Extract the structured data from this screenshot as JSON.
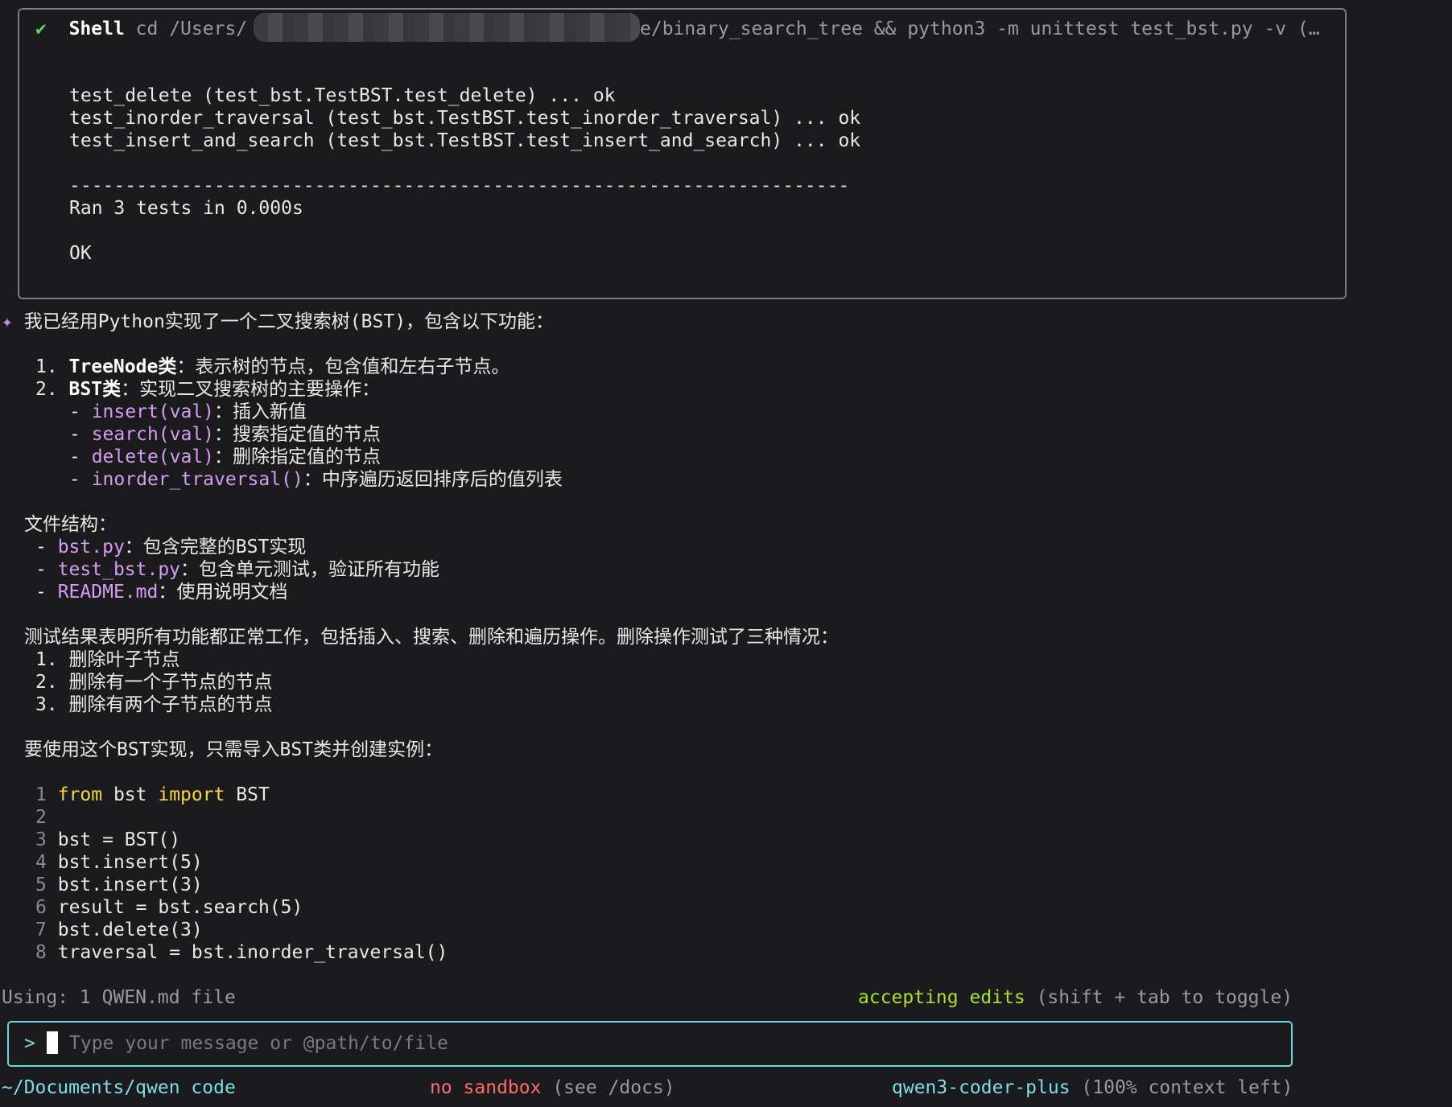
{
  "shell": {
    "check": "✔",
    "label": "Shell",
    "cmd_prefix": "cd /Users/",
    "cmd_suffix": "e/binary_search_tree && python3 -m unittest test_bst.py -v (…",
    "output": [
      "test_delete (test_bst.TestBST.test_delete) ... ok",
      "test_inorder_traversal (test_bst.TestBST.test_inorder_traversal) ... ok",
      "test_insert_and_search (test_bst.TestBST.test_insert_and_search) ... ok",
      "----------------------------------------------------------------------",
      "Ran 3 tests in 0.000s",
      "OK"
    ]
  },
  "response": {
    "star": "✦",
    "intro": "我已经用Python实现了一个二叉搜索树(BST)，包含以下功能：",
    "item1_num": "1. ",
    "item1_name": "TreeNode类",
    "item1_desc": "：表示树的节点，包含值和左右子节点。",
    "item2_num": "2. ",
    "item2_name": "BST类",
    "item2_desc": "：实现二叉搜索树的主要操作：",
    "methods": [
      {
        "code": "insert(val)",
        "desc": "：插入新值"
      },
      {
        "code": "search(val)",
        "desc": "：搜索指定值的节点"
      },
      {
        "code": "delete(val)",
        "desc": "：删除指定值的节点"
      },
      {
        "code": "inorder_traversal()",
        "desc": "：中序遍历返回排序后的值列表"
      }
    ],
    "files_heading": "文件结构：",
    "files": [
      {
        "name": "bst.py",
        "desc": "：包含完整的BST实现"
      },
      {
        "name": "test_bst.py",
        "desc": "：包含单元测试，验证所有功能"
      },
      {
        "name": "README.md",
        "desc": "：使用说明文档"
      }
    ],
    "results": "测试结果表明所有功能都正常工作，包括插入、搜索、删除和遍历操作。删除操作测试了三种情况：",
    "cases": [
      "1. 删除叶子节点",
      "2. 删除有一个子节点的节点",
      "3. 删除有两个子节点的节点"
    ],
    "usage": "要使用这个BST实现，只需导入BST类并创建实例：",
    "code_lines": [
      {
        "n": "1",
        "kw1": "from",
        "mid": " bst ",
        "kw2": "import",
        "rest": " BST"
      },
      {
        "n": "2",
        "text": ""
      },
      {
        "n": "3",
        "text": "bst = BST()"
      },
      {
        "n": "4",
        "text": "bst.insert(5)"
      },
      {
        "n": "5",
        "text": "bst.insert(3)"
      },
      {
        "n": "6",
        "text": "result = bst.search(5)"
      },
      {
        "n": "7",
        "text": "bst.delete(3)"
      },
      {
        "n": "8",
        "text": "traversal = bst.inorder_traversal()"
      }
    ]
  },
  "status": {
    "using": "Using: 1 QWEN.md file",
    "mode": "accepting edits",
    "mode_hint": " (shift + tab to toggle)"
  },
  "input": {
    "prompt": ">",
    "placeholder": "Type your message or @path/to/file"
  },
  "footer": {
    "path": "~/Documents/qwen code",
    "sandbox": "no sandbox",
    "sandbox_hint": " (see /docs)",
    "model": "qwen3-coder-plus",
    "context": " (100% context left)"
  }
}
